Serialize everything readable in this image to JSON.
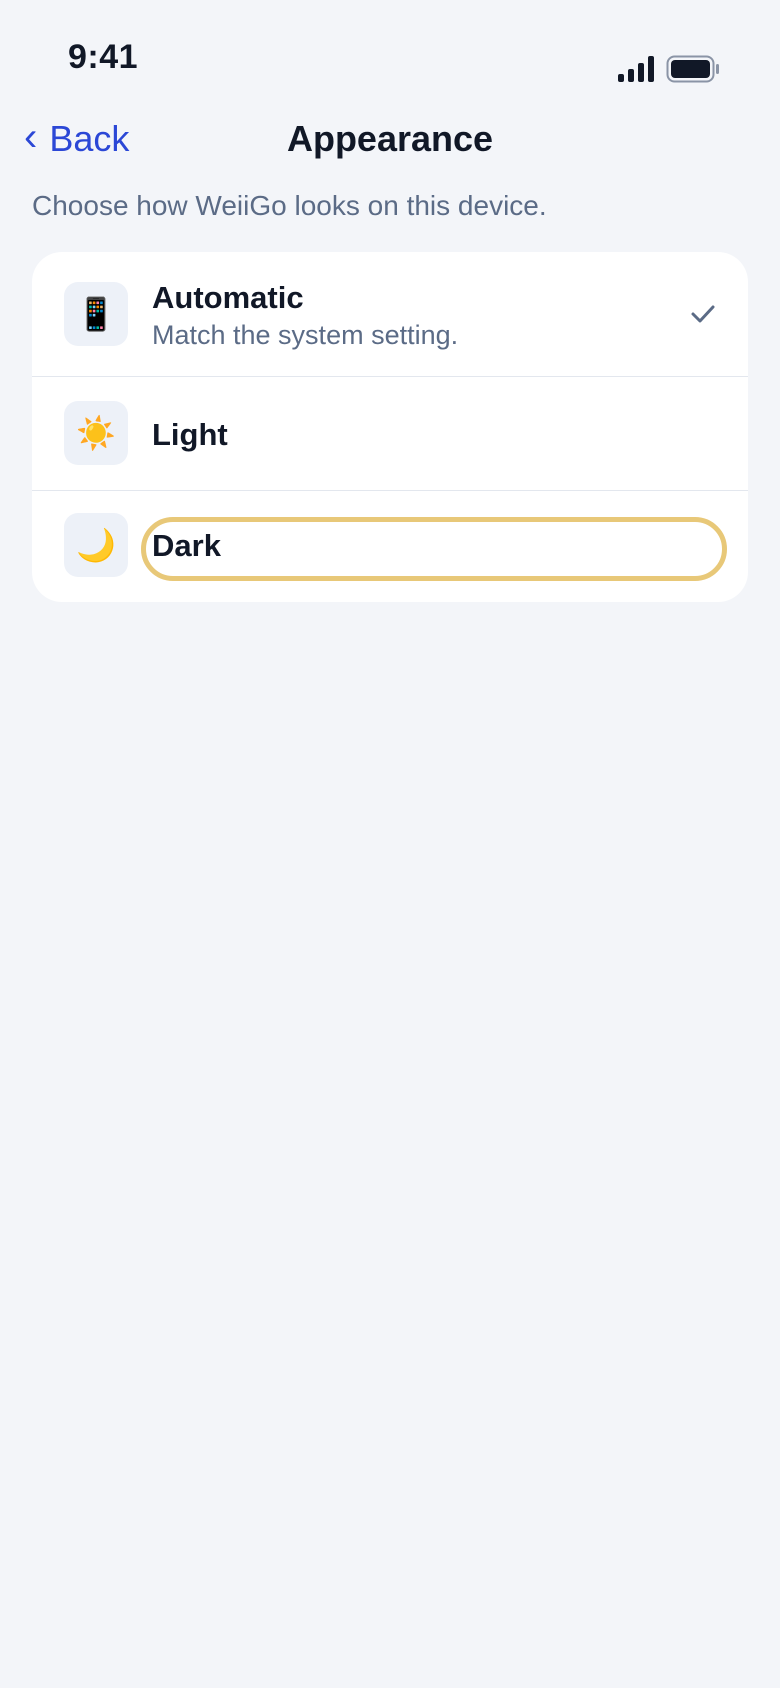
{
  "status_bar": {
    "time": "9:41"
  },
  "nav": {
    "back_label": "Back",
    "back_chevron": "‹",
    "title": "Appearance"
  },
  "subtitle": "Choose how WeiiGo looks on this device.",
  "options": [
    {
      "label": "Automatic",
      "description": "Match the system setting.",
      "icon": "📱",
      "icon_name": "phone-icon",
      "selected": true
    },
    {
      "label": "Light",
      "icon": "☀️",
      "icon_name": "sun-icon",
      "selected": false
    },
    {
      "label": "Dark",
      "icon": "🌙",
      "icon_name": "moon-icon",
      "selected": false,
      "focused": true
    }
  ],
  "colors": {
    "accent": "#2b47d6",
    "background": "#f3f5f9",
    "focus_ring": "#e8c878",
    "checkmark": "#5b6b86"
  }
}
